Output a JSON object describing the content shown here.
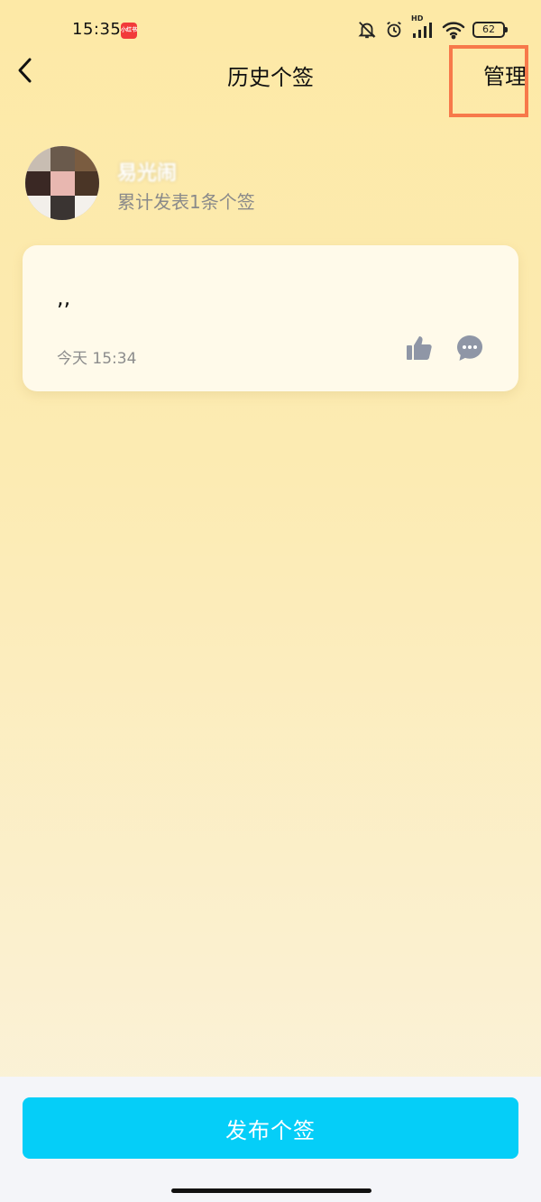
{
  "status": {
    "time": "15:35",
    "app_badge": "小红书",
    "network_label": "HD",
    "battery": "62"
  },
  "nav": {
    "title": "历史个签",
    "manage_label": "管理"
  },
  "profile": {
    "username": "易光闹",
    "post_count": "累计发表1条个签"
  },
  "post": {
    "content": ",,",
    "time": "今天 15:34"
  },
  "bottom": {
    "publish_label": "发布个签"
  },
  "icons": {
    "back": "chevron-left-icon",
    "like": "thumbs-up-icon",
    "comment": "chat-bubble-icon",
    "mute": "bell-off-icon",
    "alarm": "alarm-icon",
    "signal": "signal-icon",
    "wifi": "wifi-icon"
  },
  "colors": {
    "accent": "#05cef8",
    "highlight": "#f7794a",
    "icon_gray": "#8f96a6"
  }
}
